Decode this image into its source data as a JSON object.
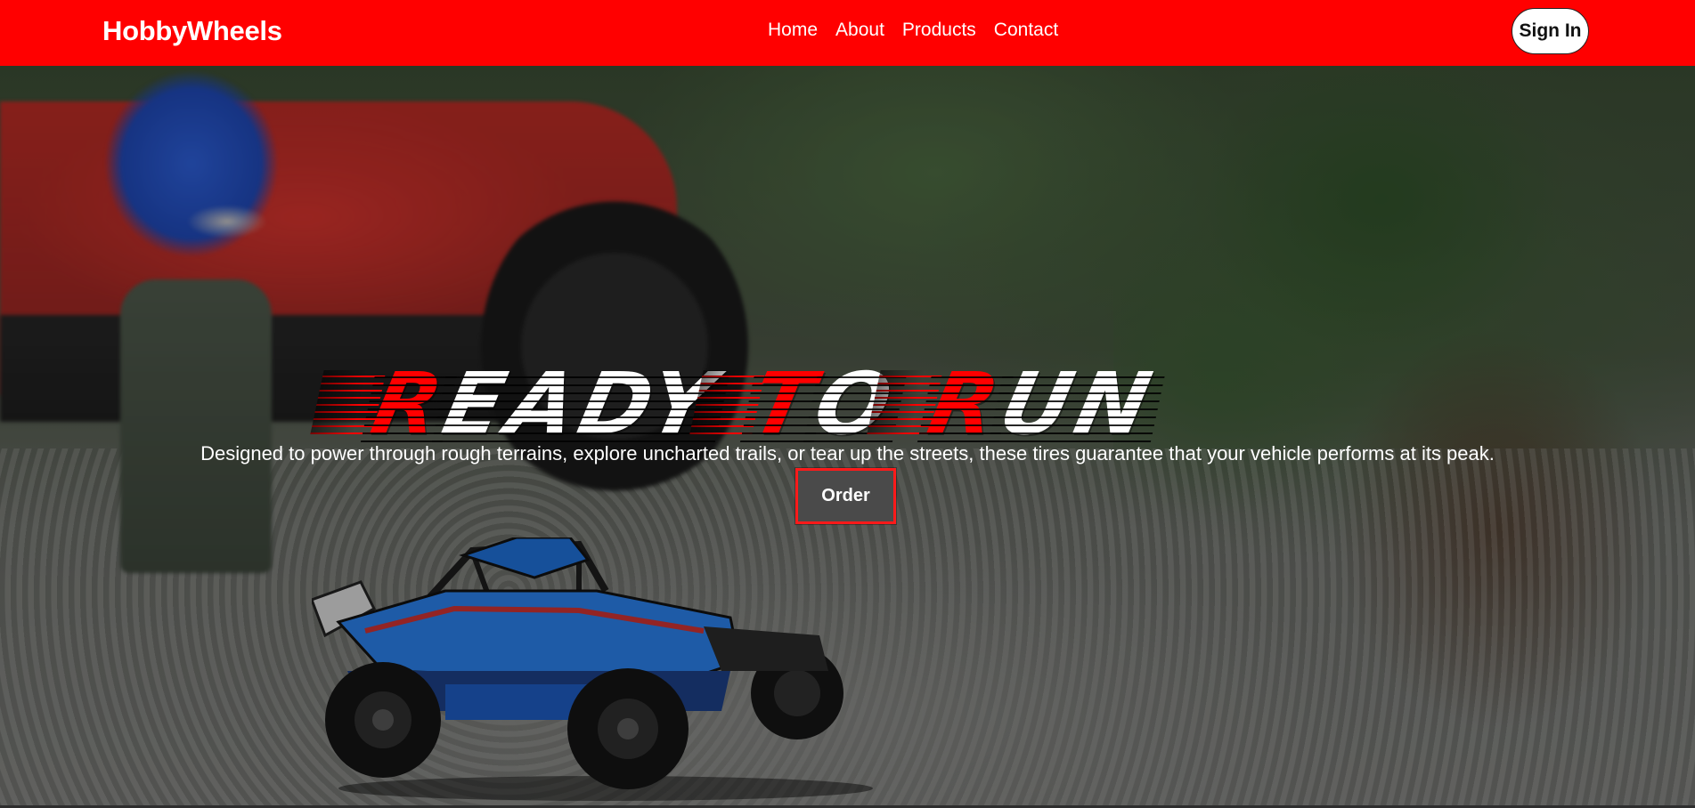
{
  "header": {
    "brand": "HobbyWheels",
    "nav": [
      {
        "label": "Home"
      },
      {
        "label": "About"
      },
      {
        "label": "Products"
      },
      {
        "label": "Contact"
      }
    ],
    "signin_label": "Sign In"
  },
  "hero": {
    "headline_words": [
      {
        "first": "R",
        "rest": "EADY"
      },
      {
        "first": "T",
        "rest": "O"
      },
      {
        "first": "R",
        "rest": "UN"
      }
    ],
    "tagline": "Designed to power through rough terrains, explore uncharted trails, or tear up the streets, these tires guarantee that your vehicle performs at its peak.",
    "order_label": "Order"
  },
  "colors": {
    "brand_red": "#ff0000",
    "button_bg": "#4a4a4a",
    "text_white": "#ffffff"
  }
}
